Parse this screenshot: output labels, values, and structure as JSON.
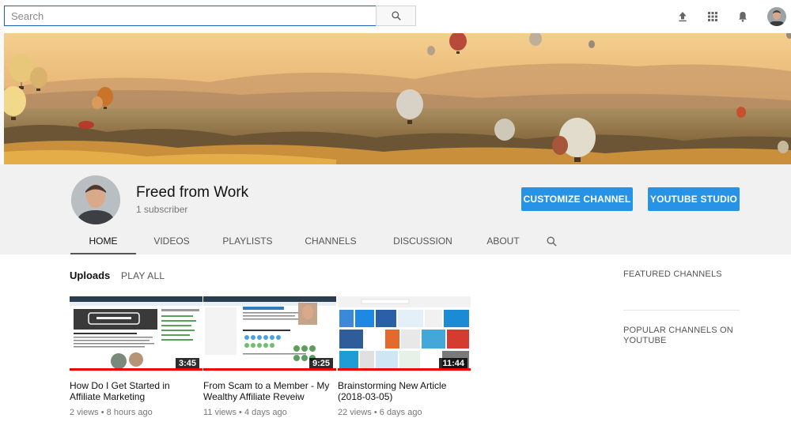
{
  "search": {
    "placeholder": "Search"
  },
  "masthead": {
    "icons": [
      "upload-icon",
      "apps-icon",
      "bell-icon"
    ]
  },
  "channel": {
    "name": "Freed from Work",
    "subscribers": "1 subscriber",
    "customize_label": "CUSTOMIZE CHANNEL",
    "studio_label": "YOUTUBE STUDIO"
  },
  "tabs": [
    "HOME",
    "VIDEOS",
    "PLAYLISTS",
    "CHANNELS",
    "DISCUSSION",
    "ABOUT"
  ],
  "uploads": {
    "title": "Uploads",
    "play_all": "PLAY ALL",
    "videos": [
      {
        "title": "How Do I Get Started in Affiliate Marketing",
        "duration": "3:45",
        "views": "2 views",
        "age": "8 hours ago",
        "watched": 1.0
      },
      {
        "title": "From Scam to a Member - My Wealthy Affiliate Reveiw",
        "duration": "9:25",
        "views": "11 views",
        "age": "4 days ago",
        "watched": 1.0
      },
      {
        "title": "Brainstorming New Article (2018-03-05)",
        "duration": "11:44",
        "views": "22 views",
        "age": "6 days ago",
        "watched": 1.0
      }
    ]
  },
  "sidebar": {
    "featured": "FEATURED CHANNELS",
    "popular": "POPULAR CHANNELS ON YOUTUBE"
  },
  "colors": {
    "accent": "#2793e6",
    "progress": "#ee0000"
  }
}
